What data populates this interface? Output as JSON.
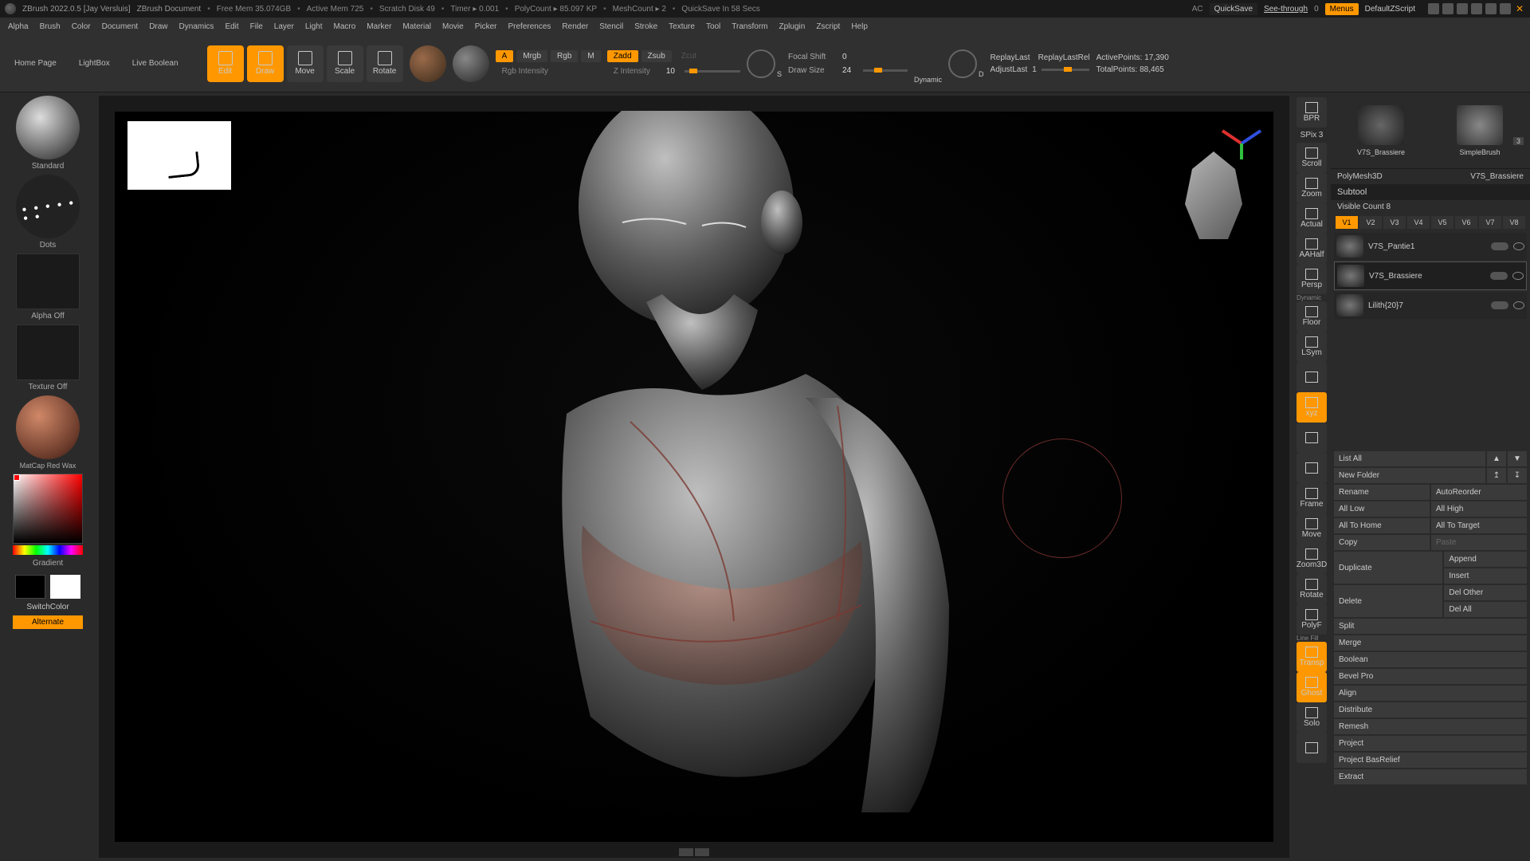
{
  "topbar": {
    "app": "ZBrush 2022.0.5 [Jay Versluis]",
    "doc": "ZBrush Document",
    "freemem": "Free Mem 35.074GB",
    "activemem": "Active Mem 725",
    "scratch": "Scratch Disk 49",
    "timer": "Timer ▸ 0.001",
    "polycount": "PolyCount ▸ 85.097 KP",
    "meshcount": "MeshCount ▸ 2",
    "quicksave_in": "QuickSave In 58 Secs",
    "ac": "AC",
    "quicksave": "QuickSave",
    "seethrough": "See-through",
    "seethrough_val": "0",
    "menus": "Menus",
    "defaultz": "DefaultZScript"
  },
  "menus": [
    "Alpha",
    "Brush",
    "Color",
    "Document",
    "Draw",
    "Dynamics",
    "Edit",
    "File",
    "Layer",
    "Light",
    "Macro",
    "Marker",
    "Material",
    "Movie",
    "Picker",
    "Preferences",
    "Render",
    "Stencil",
    "Stroke",
    "Texture",
    "Tool",
    "Transform",
    "Zplugin",
    "Zscript",
    "Help"
  ],
  "shelf": {
    "tabs": [
      "Home Page",
      "LightBox",
      "Live Boolean"
    ],
    "icons": [
      {
        "name": "edit",
        "label": "Edit",
        "on": true
      },
      {
        "name": "draw",
        "label": "Draw",
        "on": true
      },
      {
        "name": "move",
        "label": "Move",
        "on": false
      },
      {
        "name": "scale",
        "label": "Scale",
        "on": false
      },
      {
        "name": "rotate",
        "label": "Rotate",
        "on": false
      }
    ],
    "mrgb_a": "A",
    "mrgb": "Mrgb",
    "rgb": "Rgb",
    "m": "M",
    "rgb_int": "Rgb Intensity",
    "zadd": "Zadd",
    "zsub": "Zsub",
    "zcut": "Zcut",
    "zint": "Z Intensity",
    "zint_val": "10",
    "dial_s": "S",
    "dial_d": "D",
    "focal": "Focal Shift",
    "focal_val": "0",
    "drawsize": "Draw Size",
    "drawsize_val": "24",
    "dynamic": "Dynamic",
    "replay": "ReplayLast",
    "replayrel": "ReplayLastRel",
    "adjust": "AdjustLast",
    "adjust_val": "1",
    "activepts": "ActivePoints:",
    "activepts_val": "17,390",
    "totalpts": "TotalPoints:",
    "totalpts_val": "88,465"
  },
  "left": {
    "brush": "Standard",
    "stroke": "Dots",
    "alpha": "Alpha Off",
    "texture": "Texture Off",
    "material": "MatCap Red Wax",
    "gradient": "Gradient",
    "switchcolor": "SwitchColor",
    "alternate": "Alternate"
  },
  "right": {
    "spix": "SPix",
    "spix_val": "3",
    "bpr": "BPR",
    "items": [
      "Scroll",
      "Zoom",
      "Actual",
      "AAHalf",
      "Persp",
      "Floor",
      "LSym",
      "",
      "xyz",
      "",
      "",
      "Frame",
      "Move",
      "Zoom3D",
      "Rotate",
      "PolyF",
      "Transp",
      "Ghost",
      "Solo",
      ""
    ],
    "on": {
      "8": true,
      "16": true,
      "17": true
    },
    "dynamic_lbl": "Dynamic",
    "linefill": "Line Fill"
  },
  "panel": {
    "tool1": "PolyMesh3D",
    "tool2": "V7S_Brassiere",
    "toolA": "V7S_Brassiere",
    "toolB": "SimpleBrush",
    "badge": "3",
    "subtool_hdr": "Subtool",
    "visible": "Visible Count",
    "visible_val": "8",
    "vtabs": [
      "V1",
      "V2",
      "V3",
      "V4",
      "V5",
      "V6",
      "V7",
      "V8"
    ],
    "subtools": [
      {
        "name": "V7S_Pantie1"
      },
      {
        "name": "V7S_Brassiere"
      },
      {
        "name": "Lilith{20}7"
      }
    ],
    "listall": "List All",
    "newfolder": "New Folder",
    "rename": "Rename",
    "autoreorder": "AutoReorder",
    "alllow": "All Low",
    "allhigh": "All High",
    "alltohome": "All To Home",
    "alltotarget": "All To Target",
    "copy": "Copy",
    "paste": "Paste",
    "duplicate": "Duplicate",
    "append": "Append",
    "insert": "Insert",
    "delete": "Delete",
    "delother": "Del Other",
    "delall": "Del All",
    "split": "Split",
    "merge": "Merge",
    "boolean": "Boolean",
    "bevelpro": "Bevel Pro",
    "align": "Align",
    "distribute": "Distribute",
    "remesh": "Remesh",
    "project": "Project",
    "projectbas": "Project BasRelief",
    "extract": "Extract"
  }
}
